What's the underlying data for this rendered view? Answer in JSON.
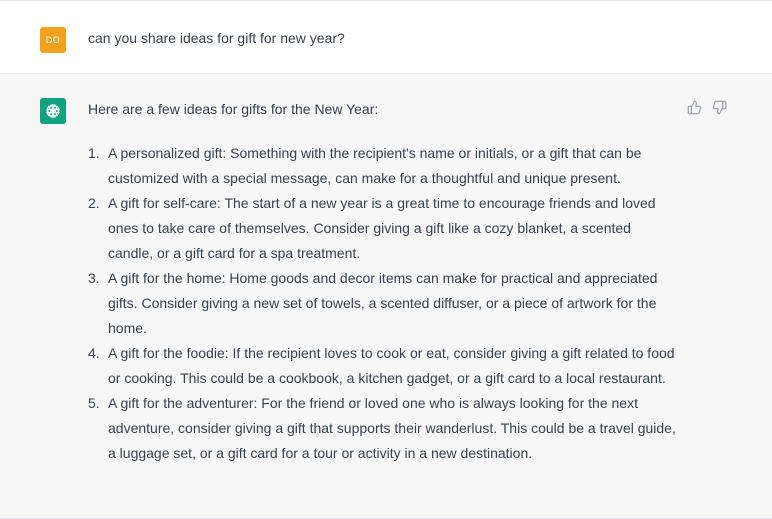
{
  "user_message": {
    "avatar_initials": "DO",
    "text": "can you share ideas for gift for new year?"
  },
  "assistant_message": {
    "intro": "Here are a few ideas for gifts for the New Year:",
    "items": [
      {
        "number": "1.",
        "text": "A personalized gift: Something with the recipient's name or initials, or a gift that can be customized with a special message, can make for a thoughtful and unique present."
      },
      {
        "number": "2.",
        "text": "A gift for self-care: The start of a new year is a great time to encourage friends and loved ones to take care of themselves. Consider giving a gift like a cozy blanket, a scented candle, or a gift card for a spa treatment."
      },
      {
        "number": "3.",
        "text": "A gift for the home: Home goods and decor items can make for practical and appreciated gifts. Consider giving a new set of towels, a scented diffuser, or a piece of artwork for the home."
      },
      {
        "number": "4.",
        "text": "A gift for the foodie: If the recipient loves to cook or eat, consider giving a gift related to food or cooking. This could be a cookbook, a kitchen gadget, or a gift card to a local restaurant."
      },
      {
        "number": "5.",
        "text": "A gift for the adventurer: For the friend or loved one who is always looking for the next adventure, consider giving a gift that supports their wanderlust. This could be a travel guide, a luggage set, or a gift card for a tour or activity in a new destination."
      }
    ]
  },
  "icons": {
    "assistant_avatar": "openai-logo-icon",
    "thumbs_up": "thumbs-up-icon",
    "thumbs_down": "thumbs-down-icon"
  },
  "colors": {
    "user_avatar_bg": "#f2a11c",
    "assistant_avatar_bg": "#10a37f",
    "assistant_row_bg": "#f7f7f8",
    "text": "#374151"
  }
}
